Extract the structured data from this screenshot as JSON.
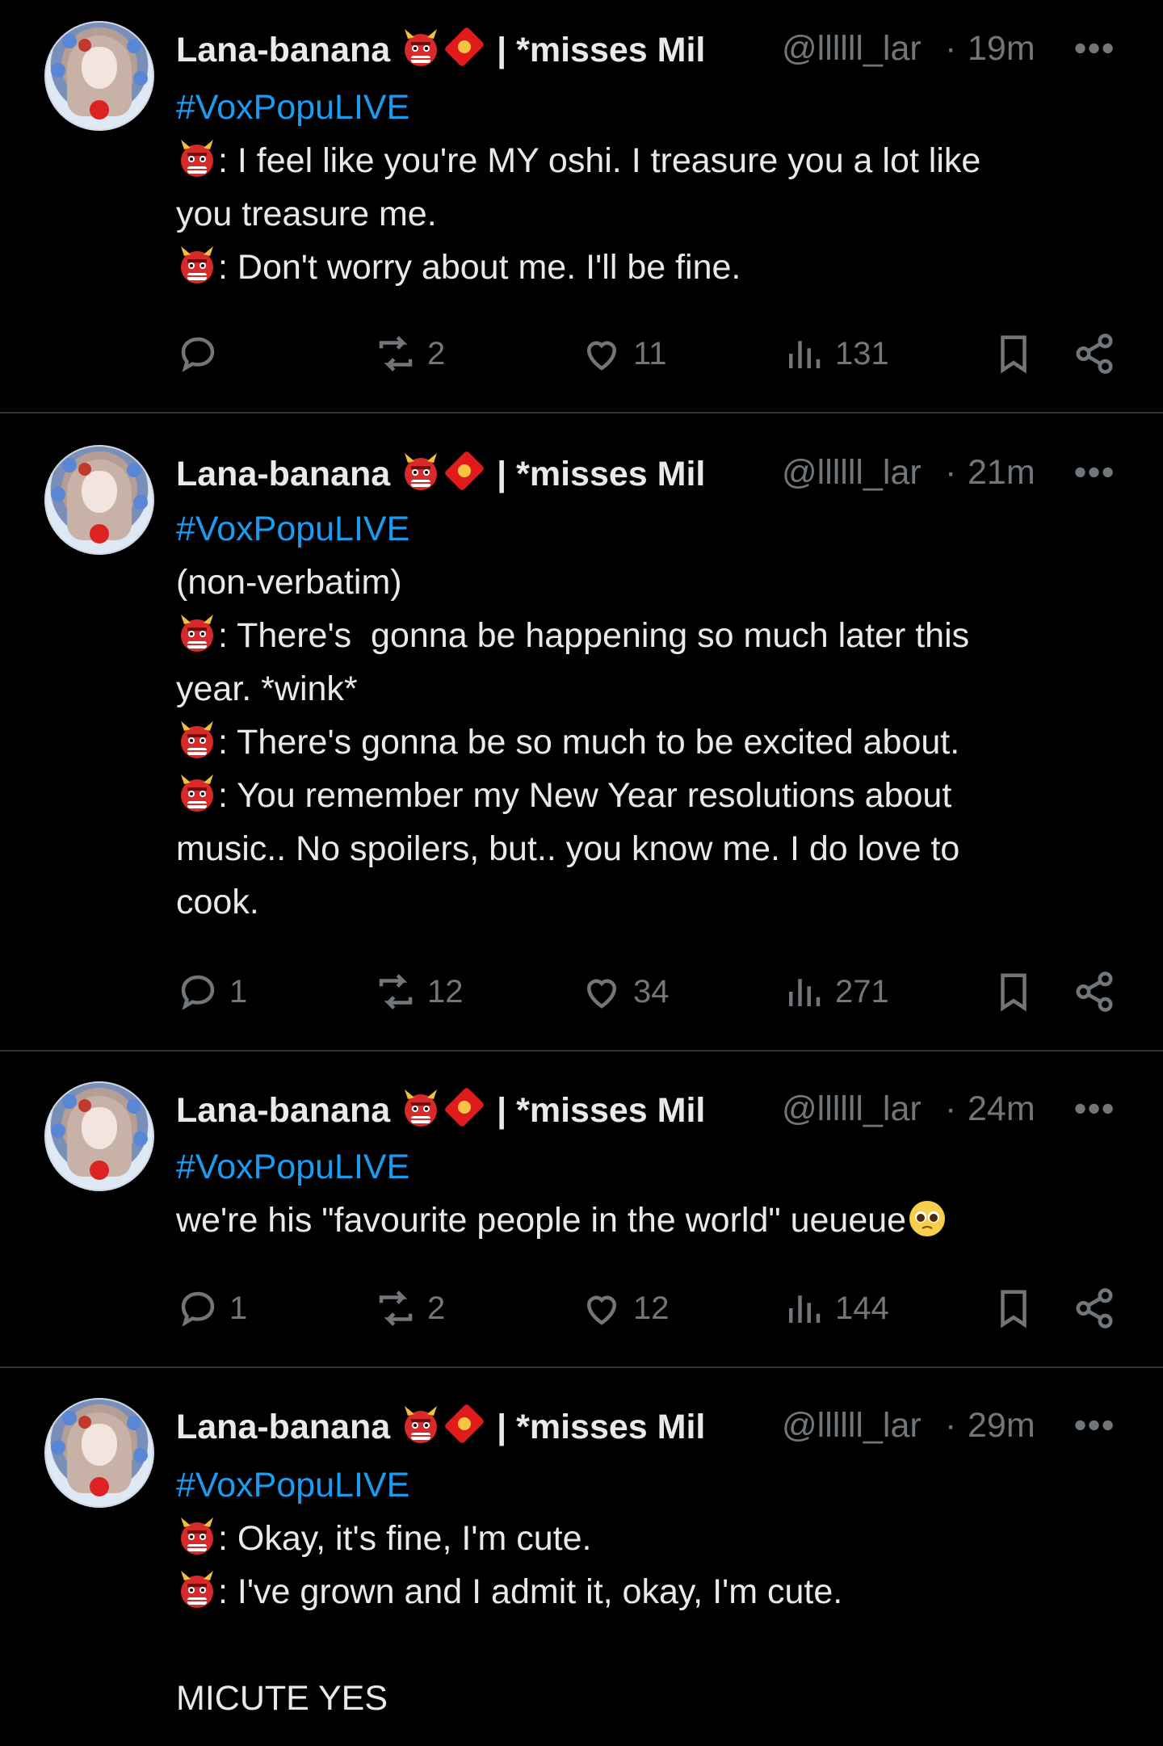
{
  "tweets": [
    {
      "name": "Lana-banana",
      "name_suffix": "| *misses Mil",
      "handle": "@llllll_lar",
      "dot": "·",
      "time": "19m",
      "more": "•••",
      "hashtag": "#VoxPopuLIVE",
      "lines": [
        {
          "emoji": true,
          "text": ": I feel like you're MY oshi. I treasure you a lot like"
        },
        {
          "emoji": false,
          "text": "you treasure me."
        },
        {
          "emoji": true,
          "text": ": Don't worry about me. I'll be fine."
        }
      ],
      "replies": "",
      "retweets": "2",
      "likes": "11",
      "views": "131"
    },
    {
      "name": "Lana-banana",
      "name_suffix": "| *misses Mil",
      "handle": "@llllll_lar",
      "dot": "·",
      "time": "21m",
      "more": "•••",
      "hashtag": "#VoxPopuLIVE",
      "lines": [
        {
          "emoji": false,
          "text": "(non-verbatim)"
        },
        {
          "emoji": true,
          "text": ": There's  gonna be happening so much later this"
        },
        {
          "emoji": false,
          "text": "year. *wink*"
        },
        {
          "emoji": true,
          "text": ": There's gonna be so much to be excited about."
        },
        {
          "emoji": true,
          "text": ": You remember my New Year resolutions about"
        },
        {
          "emoji": false,
          "text": "music.. No spoilers, but.. you know me. I do love to"
        },
        {
          "emoji": false,
          "text": "cook."
        }
      ],
      "replies": "1",
      "retweets": "12",
      "likes": "34",
      "views": "271"
    },
    {
      "name": "Lana-banana",
      "name_suffix": "| *misses Mil",
      "handle": "@llllll_lar",
      "dot": "·",
      "time": "24m",
      "more": "•••",
      "hashtag": "#VoxPopuLIVE",
      "lines": [
        {
          "emoji": false,
          "text": "we're his \"favourite people in the world\" ueueue",
          "pleading": true
        }
      ],
      "replies": "1",
      "retweets": "2",
      "likes": "12",
      "views": "144"
    },
    {
      "name": "Lana-banana",
      "name_suffix": "| *misses Mil",
      "handle": "@llllll_lar",
      "dot": "·",
      "time": "29m",
      "more": "•••",
      "hashtag": "#VoxPopuLIVE",
      "lines": [
        {
          "emoji": true,
          "text": ": Okay, it's fine, I'm cute."
        },
        {
          "emoji": true,
          "text": ": I've grown and I admit it, okay, I'm cute."
        },
        {
          "emoji": false,
          "text": ""
        },
        {
          "emoji": false,
          "text": "MICUTE YES"
        }
      ],
      "replies": "",
      "retweets": "",
      "likes": "",
      "views": ""
    }
  ],
  "icons": {
    "reply": "reply-icon",
    "retweet": "retweet-icon",
    "like": "heart-icon",
    "views": "views-icon",
    "bookmark": "bookmark-icon",
    "share": "share-icon",
    "oni": "japanese-ogre-emoji",
    "badge": "red-envelope-badge",
    "pleading": "pleading-face-emoji"
  },
  "colors": {
    "background": "#000000",
    "text": "#e7e9ea",
    "muted": "#71767b",
    "link": "#1d9bf0",
    "divider": "#2f3336"
  }
}
